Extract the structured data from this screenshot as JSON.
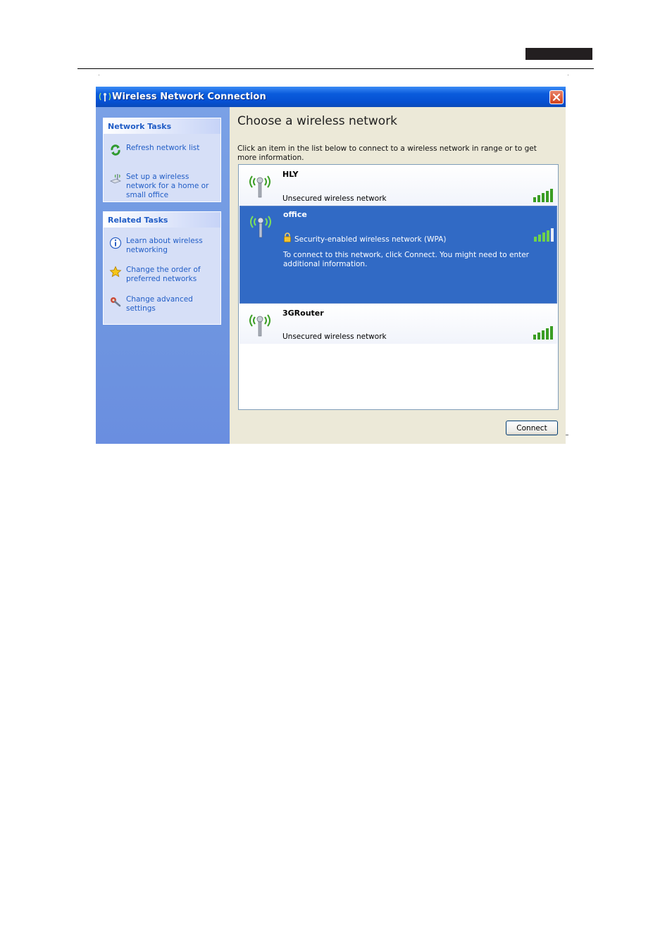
{
  "window": {
    "title": "Wireless Network Connection",
    "title_icon": "wireless-network-icon",
    "close_icon": "close-icon"
  },
  "sidebar": {
    "network_tasks": {
      "heading": "Network Tasks",
      "items": [
        {
          "label": "Refresh network list",
          "icon": "refresh-icon"
        },
        {
          "label": "Set up a wireless network for a home or small office",
          "icon": "setup-wireless-icon"
        }
      ]
    },
    "related_tasks": {
      "heading": "Related Tasks",
      "items": [
        {
          "label": "Learn about wireless networking",
          "icon": "info-icon"
        },
        {
          "label": "Change the order of preferred networks",
          "icon": "star-icon"
        },
        {
          "label": "Change advanced settings",
          "icon": "settings-icon"
        }
      ]
    }
  },
  "main": {
    "title": "Choose a wireless network",
    "instructions": "Click an item in the list below to connect to a wireless network in range or to get more information.",
    "networks": [
      {
        "name": "HLY",
        "status": "Unsecured wireless network",
        "selected": false,
        "signal_bars": 5
      },
      {
        "name": "office",
        "status": "Security-enabled wireless network (WPA)",
        "info": "To connect to this network, click Connect. You might need to enter additional information.",
        "selected": true,
        "signal_bars": 4
      },
      {
        "name": "3GRouter",
        "status": "Unsecured wireless network",
        "selected": false,
        "signal_bars": 5
      }
    ],
    "connect_label": "Connect"
  },
  "colors": {
    "titlebar": "#0a5bdc",
    "selected_row": "#316ac5",
    "task_link": "#215dc6",
    "signal": "#3a9d23"
  }
}
